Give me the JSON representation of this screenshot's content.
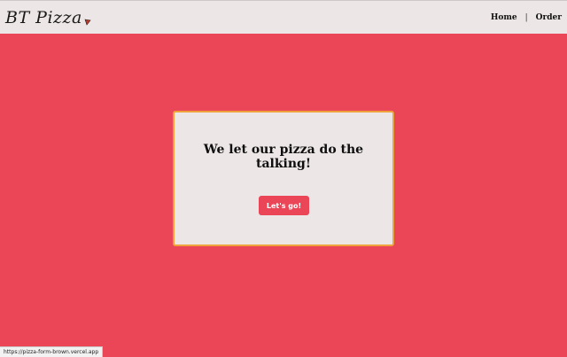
{
  "navbar": {
    "brand": "BT Pizza",
    "brand_icon": "pizza-slice-icon",
    "links": [
      {
        "label": "Home"
      },
      {
        "label": "Order"
      }
    ],
    "separator": "|"
  },
  "hero": {
    "title": "We let our pizza do the talking!",
    "button_label": "Let's go!"
  },
  "status_bar": {
    "url": "https://pizza-form-brown.vercel.app"
  },
  "colors": {
    "background": "#ea4658",
    "navbar": "#ede6e6",
    "card": "#ede6e6",
    "card_border": "#f0a23a",
    "button": "#ea4658"
  }
}
